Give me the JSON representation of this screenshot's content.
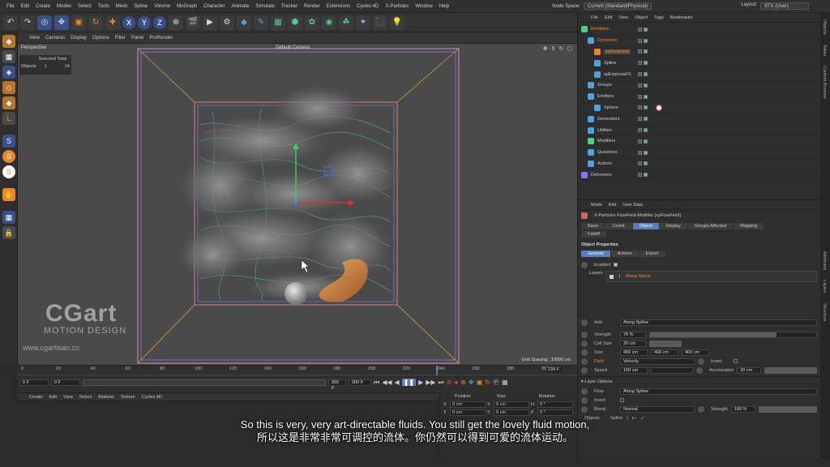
{
  "menu": [
    "File",
    "Edit",
    "Create",
    "Modes",
    "Select",
    "Tools",
    "Mesh",
    "Spline",
    "Volume",
    "MoGraph",
    "Character",
    "Animate",
    "Simulate",
    "Tracker",
    "Render",
    "Extensions",
    "Cycles 4D",
    "X-Particles",
    "Window",
    "Help"
  ],
  "node_space": {
    "label": "Node Space:",
    "value": "Current (Standard/Physical)"
  },
  "layout": {
    "label": "Layout:",
    "value": "STX (User)"
  },
  "toolbar_axes": [
    "X",
    "Y",
    "Z"
  ],
  "viewport": {
    "menu": [
      "View",
      "Cameras",
      "Display",
      "Options",
      "Filter",
      "Panel",
      "ProRender"
    ],
    "name": "Perspective",
    "camera": "Default Camera",
    "grid_spacing": "Grid Spacing : 10000 cm",
    "hud": {
      "selected_total": "Selected Total",
      "objects_label": "Objects",
      "objects_selected": "1",
      "objects_total": "24"
    }
  },
  "logo": {
    "main": "CGart",
    "sub": "MOTION DESIGN",
    "url": "www.cgartisan.cn"
  },
  "timeline": {
    "ticks": [
      "0",
      "20",
      "40",
      "60",
      "80",
      "100",
      "120",
      "140",
      "160",
      "180",
      "200",
      "220",
      "240",
      "260",
      "280",
      "300"
    ],
    "current_frame": "239 F",
    "start": "0 F",
    "field2": "0 F",
    "end": "300 F",
    "end2": "300 F"
  },
  "material_menu": [
    "Create",
    "Edit",
    "View",
    "Select",
    "Material",
    "Texture",
    "Cycles 4D"
  ],
  "coords": {
    "headers": [
      "Position",
      "Size",
      "Rotation"
    ],
    "rows": [
      [
        "X",
        "0 cm",
        "X",
        "0 cm",
        "H",
        "0 °"
      ],
      [
        "Y",
        "0 cm",
        "Y",
        "0 cm",
        "P",
        "0 °"
      ]
    ]
  },
  "object_manager": {
    "menu": [
      "File",
      "Edit",
      "View",
      "Object",
      "Tags",
      "Bookmarks"
    ],
    "items": [
      "Modifiers",
      "Dynamics",
      "xpFlowField",
      "Spline",
      "xpExplosiaFX",
      "Groups",
      "Emitters",
      "Sphere",
      "Generators",
      "Utilities",
      "Modifiers",
      "Questions",
      "Actions",
      "Deformers"
    ]
  },
  "attributes": {
    "menu": [
      "Mode",
      "Edit",
      "User Data"
    ],
    "title": "X-Particles FlowField-Modifier [xpFlowField]",
    "tabs": [
      "Basic",
      "Coord.",
      "Object",
      "Display",
      "Groups Affected",
      "Mapping"
    ],
    "tab_extra": "Falloff",
    "section": "Object Properties",
    "subtabs": [
      "General",
      "Actions",
      "Export"
    ],
    "enabled_label": "Enabled",
    "layers_label": "Layers",
    "layer_item": "Along Spline",
    "add_label": "Add",
    "add_value": "Along Spline",
    "strength": {
      "label": "Strength",
      "value": "76 %",
      "fill": 0.76
    },
    "cell_size": {
      "label": "Cell Size",
      "value": "20 cm"
    },
    "size": {
      "label": "Size",
      "values": [
        "400 cm",
        "400 cm",
        "400 cm"
      ]
    },
    "field": {
      "label": "Field",
      "value": "Velocity",
      "invert": "Invert"
    },
    "speed": {
      "label": "Speed",
      "value": "150 cm",
      "accel_label": "Acceleration",
      "accel_value": "20 cm"
    },
    "layer_options": "Layer Options",
    "flow": {
      "label": "Flow",
      "value": "Along Spline"
    },
    "invert": "Invert",
    "blend": {
      "label": "Blend",
      "value": "Normal",
      "strength_label": "Strength",
      "strength_value": "100 %"
    },
    "objects_label": "Objects",
    "spline_label": "Spline"
  },
  "side_tabs": [
    "Objects",
    "Takes",
    "Content Browser",
    "Attributes",
    "Layers",
    "Structure"
  ],
  "subtitles": {
    "en": "So this is very, very art-directable fluids. You still get the lovely fluid motion,",
    "zh": "所以这是非常非常可调控的流体。你仍然可以得到可爱的流体运动。"
  },
  "colors": {
    "accent": "#5a7dbd",
    "orange": "#e8882a",
    "bg": "#2b2b2b"
  }
}
